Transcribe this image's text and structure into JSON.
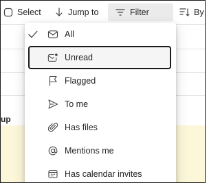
{
  "toolbar": {
    "select_label": "Select",
    "jump_label": "Jump to",
    "filter_label": "Filter",
    "sort_label": "By Date"
  },
  "list": {
    "group_label_fragment": "up"
  },
  "filter_menu": {
    "items": [
      {
        "label": "All",
        "icon": "envelope-icon",
        "checked": true
      },
      {
        "label": "Unread",
        "icon": "envelope-unread-icon",
        "checked": false
      },
      {
        "label": "Flagged",
        "icon": "flag-icon",
        "checked": false
      },
      {
        "label": "To me",
        "icon": "send-icon",
        "checked": false
      },
      {
        "label": "Has files",
        "icon": "paperclip-icon",
        "checked": false
      },
      {
        "label": "Mentions me",
        "icon": "at-sign-icon",
        "checked": false
      },
      {
        "label": "Has calendar invites",
        "icon": "calendar-icon",
        "checked": false
      }
    ]
  },
  "colors": {
    "highlight_row": "#fdf7da",
    "toolbar_active": "#ebebeb",
    "focus_border": "#1b1b1b"
  }
}
